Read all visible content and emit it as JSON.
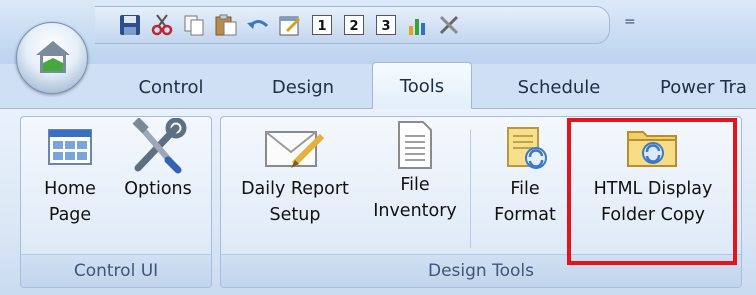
{
  "tabs": [
    {
      "label": "Control"
    },
    {
      "label": "Design"
    },
    {
      "label": "Tools"
    },
    {
      "label": "Schedule"
    },
    {
      "label": "Power Tra"
    }
  ],
  "groups": {
    "control_ui": {
      "label": "Control UI",
      "buttons": [
        {
          "line1": "Home",
          "line2": "Page",
          "icon": "home-page-icon"
        },
        {
          "line1": "Options",
          "line2": "",
          "icon": "options-tools-icon"
        }
      ]
    },
    "design_tools": {
      "label": "Design Tools",
      "buttons": [
        {
          "line1": "Daily Report",
          "line2": "Setup",
          "icon": "envelope-pencil-icon"
        },
        {
          "line1": "File",
          "line2": "Inventory",
          "icon": "document-icon"
        },
        {
          "line1": "File",
          "line2": "Format",
          "icon": "file-format-icon"
        },
        {
          "line1": "HTML Display",
          "line2": "Folder Copy",
          "icon": "folder-copy-icon"
        }
      ]
    }
  },
  "quick_access": {
    "items": [
      "save-icon",
      "cut-icon",
      "copy-icon",
      "paste-icon",
      "undo-icon",
      "calendar-icon",
      "calendar-1-icon",
      "calendar-2-icon",
      "calendar-3-icon",
      "chart-icon",
      "tools-icon"
    ],
    "calendar_numbers": [
      "1",
      "2",
      "3"
    ],
    "dropdown": "="
  },
  "colors": {
    "highlight": "#e3141b",
    "accent": "#1c2f47"
  }
}
